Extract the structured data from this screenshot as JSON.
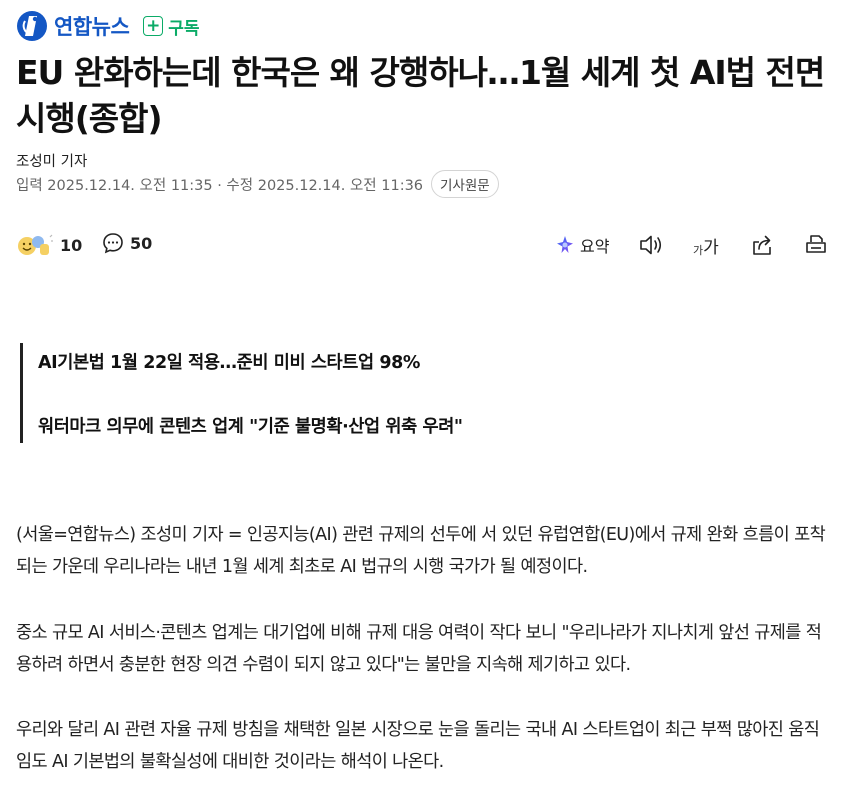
{
  "press": {
    "name": "연합뉴스",
    "subscribe_label": "구독",
    "subscribe_symbol": "+",
    "brand_color": "#1457c4",
    "subscribe_color": "#0bab67"
  },
  "article": {
    "title": "EU 완화하는데 한국은 왜 강행하나…1월 세계 첫 AI법 전면 시행(종합)",
    "byline": "조성미 기자",
    "dates": "입력 2025.12.14. 오전 11:35 · 수정 2025.12.14. 오전 11:36",
    "original_button": "기사원문"
  },
  "tools": {
    "reaction_count": "10",
    "comment_count": "50",
    "summary_label": "요약",
    "fontsize_small": "가",
    "fontsize_big": "가"
  },
  "subheads": [
    "AI기본법 1월 22일 적용…준비 미비 스타트업 98%",
    "워터마크 의무에 콘텐츠 업계 \"기준 불명확·산업 위축 우려\""
  ],
  "body": [
    "(서울=연합뉴스) 조성미 기자 = 인공지능(AI) 관련 규제의 선두에 서 있던 유럽연합(EU)에서 규제 완화 흐름이 포착되는 가운데 우리나라는 내년 1월 세계 최초로 AI 법규의 시행 국가가 될 예정이다.",
    "중소 규모 AI 서비스·콘텐츠 업계는 대기업에 비해 규제 대응 여력이 작다 보니 \"우리나라가 지나치게 앞선 규제를 적용하려 하면서 충분한 현장 의견 수렴이 되지 않고 있다\"는 불만을 지속해 제기하고 있다.",
    "우리와 달리 AI 관련 자율 규제 방침을 채택한 일본 시장으로 눈을 돌리는 국내 AI 스타트업이 최근 부쩍 많아진 움직임도 AI 기본법의 불확실성에 대비한 것이라는 해석이 나온다."
  ],
  "icons": {
    "logo": "yonhap-logo-icon",
    "subscribe": "plus-box-icon",
    "reaction": "emoji-reaction-icon",
    "comment": "speech-bubble-icon",
    "summary": "sparkle-icon",
    "tts": "speaker-icon",
    "font": "font-size-icon",
    "share": "share-icon",
    "print": "print-icon"
  }
}
